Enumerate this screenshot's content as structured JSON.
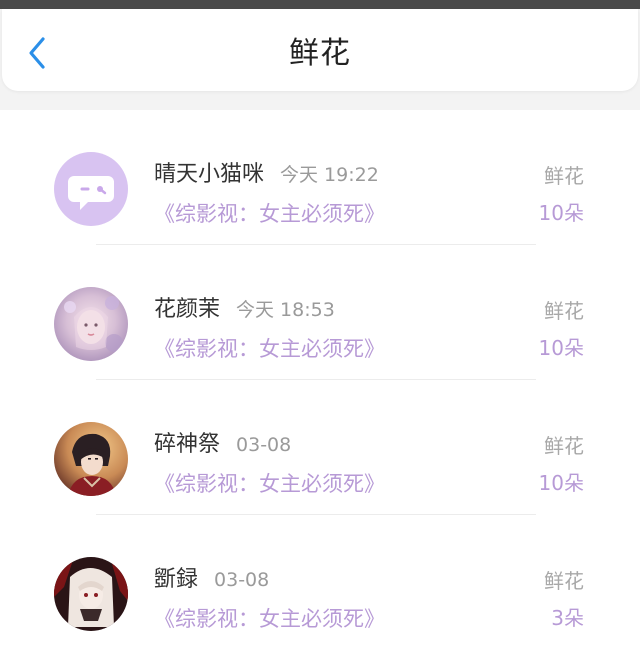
{
  "header": {
    "title": "鲜花",
    "back_icon": "chevron-left-icon",
    "accent_color": "#2b8fe8"
  },
  "colors": {
    "purple_text": "#b79ad6",
    "muted_text": "#a8a8a8"
  },
  "items": [
    {
      "name": "晴天小猫咪",
      "time": "今天 19:22",
      "book": "《综影视：女主必须死》",
      "gift_label": "鲜花",
      "gift_count": "10朵",
      "avatar": "default-chat-avatar-icon"
    },
    {
      "name": "花颜茉",
      "time": "今天 18:53",
      "book": "《综影视：女主必须死》",
      "gift_label": "鲜花",
      "gift_count": "10朵",
      "avatar": "user-avatar"
    },
    {
      "name": "碎神祭",
      "time": "03-08",
      "book": "《综影视：女主必须死》",
      "gift_label": "鲜花",
      "gift_count": "10朵",
      "avatar": "user-avatar"
    },
    {
      "name": "斵録",
      "time": "03-08",
      "book": "《综影视：女主必须死》",
      "gift_label": "鲜花",
      "gift_count": "3朵",
      "avatar": "user-avatar"
    }
  ]
}
